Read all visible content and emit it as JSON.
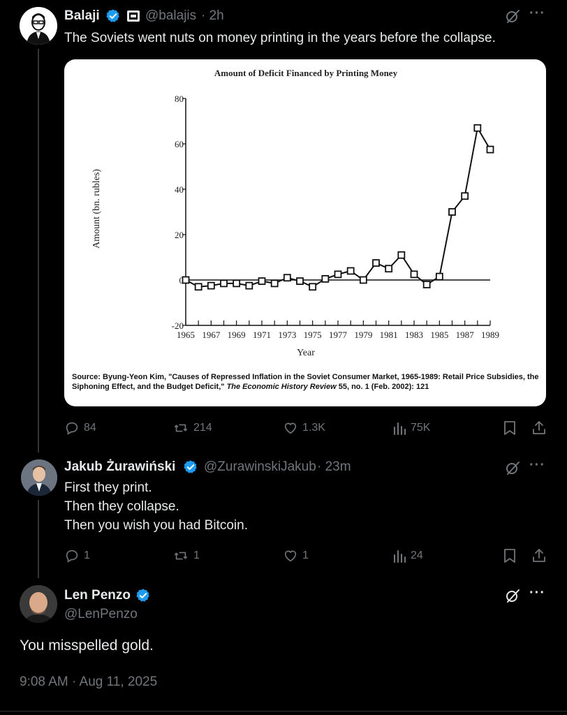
{
  "tweet1": {
    "name": "Balaji",
    "handle": "@balajis",
    "time": "· 2h",
    "text": "The Soviets went nuts on money printing in the years before the collapse.",
    "actions": {
      "replies": "84",
      "reposts": "214",
      "likes": "1.3K",
      "views": "75K"
    }
  },
  "chart_data": {
    "type": "line",
    "title": "Amount of Deficit Financed by Printing Money",
    "xlabel": "Year",
    "ylabel": "Amount (bn. rubles)",
    "xlim": [
      1965,
      1989
    ],
    "ylim": [
      -20,
      80
    ],
    "xticks": [
      1965,
      1967,
      1969,
      1971,
      1973,
      1975,
      1977,
      1979,
      1981,
      1983,
      1985,
      1987,
      1989
    ],
    "yticks": [
      -20,
      0,
      20,
      40,
      60,
      80
    ],
    "x": [
      1965,
      1966,
      1967,
      1968,
      1969,
      1970,
      1971,
      1972,
      1973,
      1974,
      1975,
      1976,
      1977,
      1978,
      1979,
      1980,
      1981,
      1982,
      1983,
      1984,
      1985,
      1986,
      1987,
      1988,
      1989
    ],
    "y": [
      0,
      -3,
      -2.5,
      -1.5,
      -1.5,
      -2.5,
      -0.5,
      -1.5,
      1,
      -0.5,
      -3,
      0.5,
      2.5,
      4,
      0,
      7.5,
      5,
      11,
      2.5,
      -2,
      1.5,
      30,
      37,
      67,
      57.5
    ],
    "marker": "square",
    "source_label": "Source:",
    "source_text": "Byung-Yeon Kim, \"Causes of Repressed Inflation in the Soviet Consumer Market, 1965-1989: Retail Price Subsidies, the Siphoning Effect, and the Budget Deficit,\"",
    "source_journal": "The Economic History Review",
    "source_tail": "55, no. 1 (Feb. 2002): 121"
  },
  "tweet2": {
    "name": "Jakub Żurawiński",
    "handle": "@ZurawinskiJakub",
    "time": "· 23m",
    "lines": [
      "First they print.",
      "Then they collapse.",
      "Then you wish you had Bitcoin."
    ],
    "actions": {
      "replies": "1",
      "reposts": "1",
      "likes": "1",
      "views": "24"
    }
  },
  "tweet3": {
    "name": "Len Penzo",
    "handle": "@LenPenzo",
    "text": "You misspelled gold.",
    "timestamp": "9:08 AM · Aug 11, 2025"
  },
  "colors": {
    "verified": "#1d9bf0",
    "muted": "#71767b",
    "text": "#e7e9ea"
  }
}
